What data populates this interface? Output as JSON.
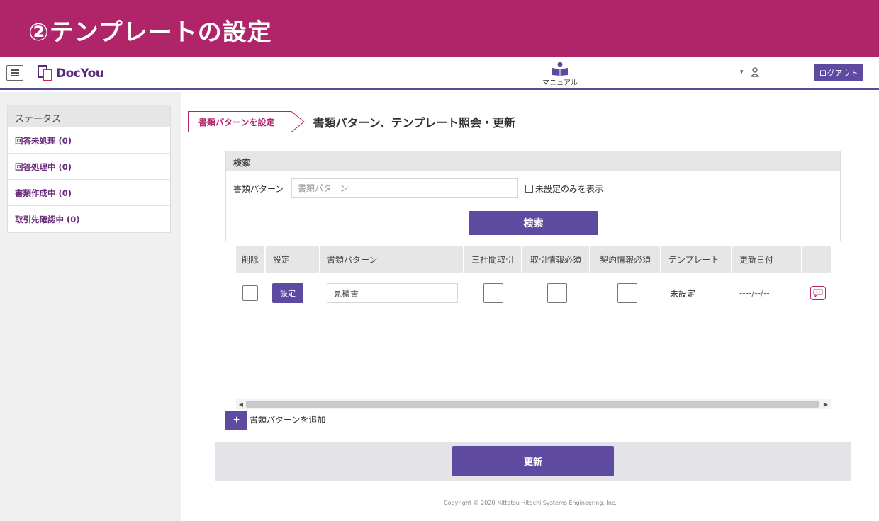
{
  "banner": {
    "title": "②テンプレートの設定"
  },
  "header": {
    "logo_text": "DocYou",
    "manual_label": "マニュアル",
    "logout_label": "ログアウト"
  },
  "sidebar": {
    "heading": "ステータス",
    "items": [
      {
        "label": "回答未処理 (0)"
      },
      {
        "label": "回答処理中 (0)"
      },
      {
        "label": "書類作成中 (0)"
      },
      {
        "label": "取引先確認中 (0)"
      }
    ]
  },
  "breadcrumb": {
    "tag": "書類パターンを設定",
    "title": "書類パターン、テンプレート照会・更新"
  },
  "search": {
    "heading": "検索",
    "pattern_label": "書類パターン",
    "pattern_placeholder": "書類パターン",
    "unset_only_label": "未設定のみを表示",
    "button_label": "検索"
  },
  "table": {
    "columns": [
      "削除",
      "設定",
      "書類パターン",
      "三社間取引",
      "取引情報必須",
      "契約情報必須",
      "テンプレート",
      "更新日付",
      ""
    ],
    "rows": [
      {
        "set_label": "設定",
        "pattern": "見積書",
        "template": "未設定",
        "updated": "----/--/--"
      }
    ]
  },
  "add": {
    "button": "+",
    "label": "書類パターンを追加"
  },
  "update_button": "更新",
  "copyright": "Copyright © 2020 Nittetsu Hitachi Systems Engineering, Inc.",
  "colors": {
    "banner": "#b0256a",
    "primary": "#5e4aa0",
    "accent": "#6a2d7c"
  },
  "icons": [
    "menu-icon",
    "docyou-logo-icon",
    "manual-book-icon",
    "user-icon",
    "comment-icon"
  ]
}
